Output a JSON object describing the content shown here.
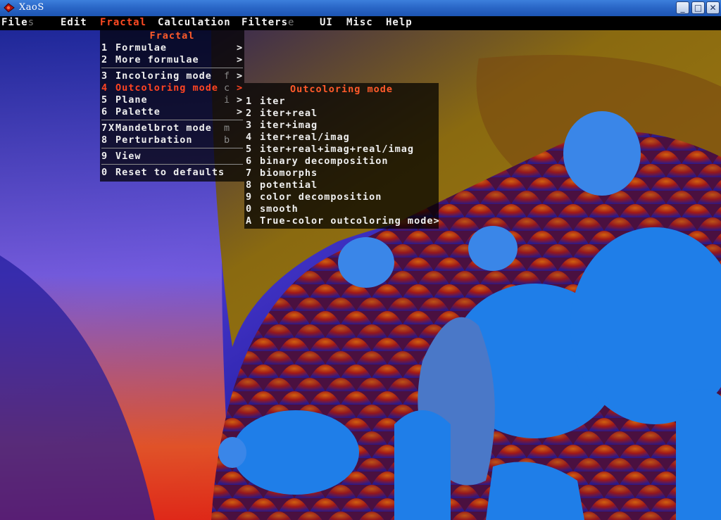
{
  "window": {
    "title": "XaoS",
    "buttons": {
      "minimize": "_",
      "maximize": "□",
      "close": "✕"
    }
  },
  "menubar": {
    "items": [
      {
        "label": "File",
        "key": "s"
      },
      {
        "label": "Edit",
        "key": ""
      },
      {
        "label": "Fractal",
        "key": "",
        "active": true
      },
      {
        "label": "Calculation",
        "key": ""
      },
      {
        "label": "Filters",
        "key": "e"
      },
      {
        "label": "UI",
        "key": ""
      },
      {
        "label": "Misc",
        "key": ""
      },
      {
        "label": "Help",
        "key": ""
      }
    ]
  },
  "fractal_menu": {
    "title": "Fractal",
    "items": [
      {
        "num": "1",
        "label": "Formulae",
        "shortcut": "",
        "submenu": true
      },
      {
        "num": "2",
        "label": "More formulae",
        "shortcut": "",
        "submenu": true
      },
      {
        "num": "3",
        "label": "Incoloring mode",
        "shortcut": "f",
        "submenu": true
      },
      {
        "num": "4",
        "label": "Outcoloring mode",
        "shortcut": "c",
        "submenu": true,
        "highlighted": true
      },
      {
        "num": "5",
        "label": "Plane",
        "shortcut": "i",
        "submenu": true
      },
      {
        "num": "6",
        "label": "Palette",
        "shortcut": "",
        "submenu": true
      },
      {
        "num": "7",
        "check": "X",
        "label": "Mandelbrot mode",
        "shortcut": "m",
        "submenu": false
      },
      {
        "num": "8",
        "label": "Perturbation",
        "shortcut": "b",
        "submenu": false
      },
      {
        "num": "9",
        "label": "View",
        "shortcut": "",
        "submenu": false
      },
      {
        "num": "0",
        "label": "Reset to defaults",
        "shortcut": "",
        "submenu": false
      }
    ]
  },
  "outcoloring_menu": {
    "title": "Outcoloring mode",
    "items": [
      {
        "num": "1",
        "label": "iter"
      },
      {
        "num": "2",
        "label": "iter+real"
      },
      {
        "num": "3",
        "label": "iter+imag"
      },
      {
        "num": "4",
        "label": "iter+real/imag"
      },
      {
        "num": "5",
        "label": "iter+real+imag+real/imag"
      },
      {
        "num": "6",
        "label": "binary decomposition"
      },
      {
        "num": "7",
        "label": "biomorphs"
      },
      {
        "num": "8",
        "label": "potential"
      },
      {
        "num": "9",
        "label": "color decomposition"
      },
      {
        "num": "0",
        "label": "smooth"
      },
      {
        "num": "A",
        "label": "True-color outcoloring mode>"
      }
    ]
  },
  "colors": {
    "accent": "#ff4a22",
    "menu_text": "#efefef",
    "shortcut": "#8a8a8a",
    "titlebar": "#2a67c7"
  },
  "icons": {
    "app": "xaos-fractal-icon",
    "submenu": "submenu-arrow-icon"
  },
  "submenu_arrow": ">"
}
